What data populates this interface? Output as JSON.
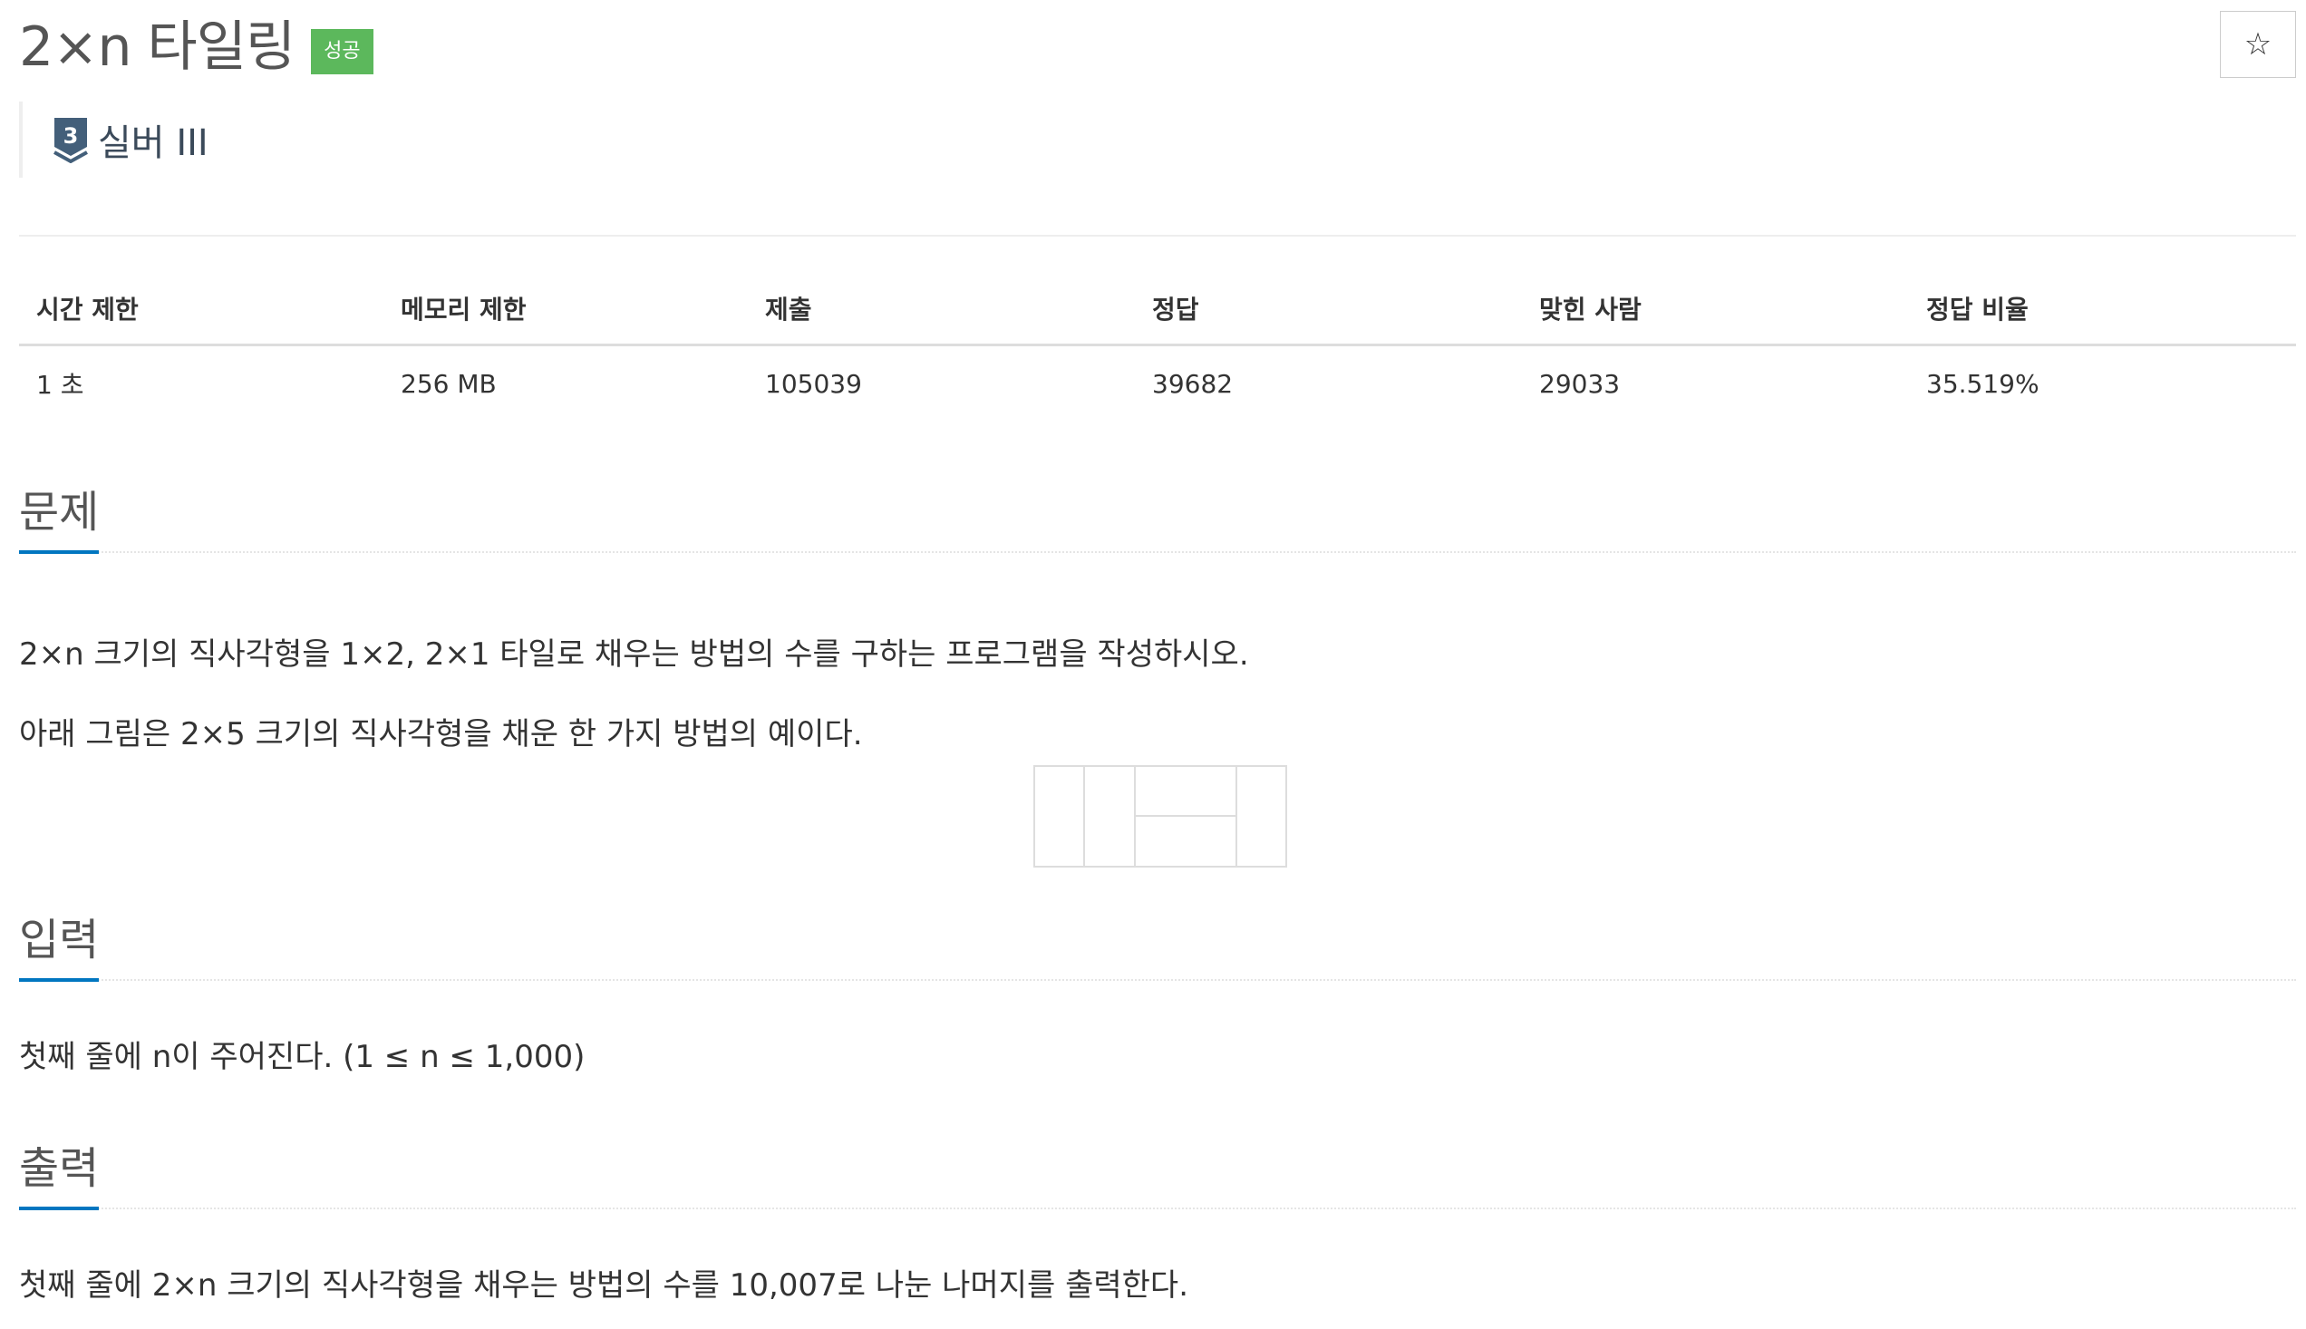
{
  "header": {
    "title": "2×n 타일링",
    "result_badge": "성공",
    "star_icon": "star-outline-icon",
    "star_glyph": "☆"
  },
  "tier": {
    "icon": "silver-shield-icon",
    "icon_number": "3",
    "label": "실버 III",
    "color": "#3b4a5a"
  },
  "info_table": {
    "headers": [
      "시간 제한",
      "메모리 제한",
      "제출",
      "정답",
      "맞힌 사람",
      "정답 비율"
    ],
    "values": [
      "1 초",
      "256 MB",
      "105039",
      "39682",
      "29033",
      "35.519%"
    ]
  },
  "sections": {
    "problem": {
      "title": "문제",
      "paragraphs": [
        "2×n 크기의 직사각형을 1×2, 2×1 타일로 채우는 방법의 수를 구하는 프로그램을 작성하시오.",
        "아래 그림은 2×5 크기의 직사각형을 채운 한 가지 방법의 예이다."
      ]
    },
    "input": {
      "title": "입력",
      "text": "첫째 줄에 n이 주어진다. (1 ≤ n ≤ 1,000)"
    },
    "output": {
      "title": "출력",
      "text": "첫째 줄에 2×n 크기의 직사각형을 채우는 방법의 수를 10,007로 나눈 나머지를 출력한다."
    }
  },
  "colors": {
    "success_badge": "#5cb85c",
    "section_underline": "#0076c0",
    "tier_silver": "#435f7a"
  }
}
